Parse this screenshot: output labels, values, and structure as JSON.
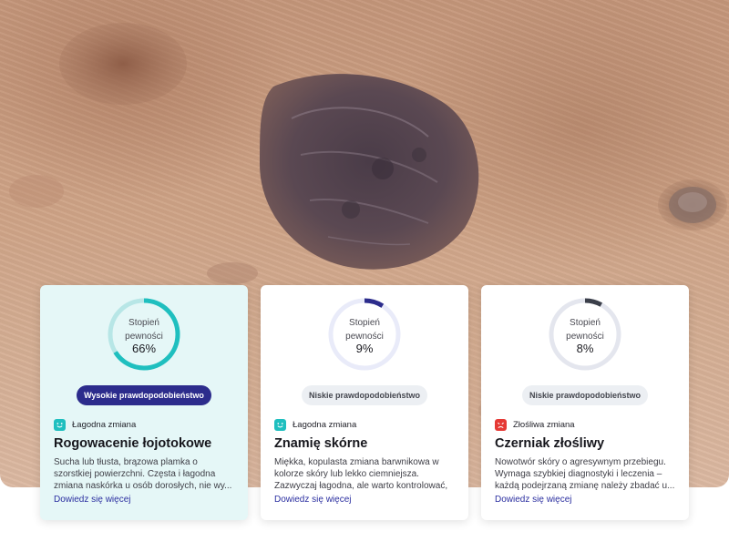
{
  "cards": [
    {
      "confidence_label_1": "Stopień",
      "confidence_label_2": "pewności",
      "confidence_value": "66%",
      "confidence_fraction": 0.66,
      "badge": "Wysokie prawdopodobieństwo",
      "type_label": "Łagodna zmiana",
      "type_icon": "happy-face-icon",
      "title": "Rogowacenie łojotokowe",
      "description": "Sucha lub tłusta, brązowa plamka o szorstkiej powierzchni. Częsta i łagodna zmiana naskórka u osób dorosłych, nie wy...",
      "link": "Dowiedz się więcej"
    },
    {
      "confidence_label_1": "Stopień",
      "confidence_label_2": "pewności",
      "confidence_value": "9%",
      "confidence_fraction": 0.09,
      "badge": "Niskie prawdopodobieństwo",
      "type_label": "Łagodna zmiana",
      "type_icon": "happy-face-icon",
      "title": "Znamię skórne",
      "description": "Miękka, kopulasta zmiana barwnikowa w kolorze skóry lub lekko ciemniejsza. Zazwyczaj łagodna, ale warto kontrolować, ...",
      "link": "Dowiedz się więcej"
    },
    {
      "confidence_label_1": "Stopień",
      "confidence_label_2": "pewności",
      "confidence_value": "8%",
      "confidence_fraction": 0.08,
      "badge": "Niskie prawdopodobieństwo",
      "type_label": "Złośliwa zmiana",
      "type_icon": "sad-face-icon",
      "title": "Czerniak złośliwy",
      "description": "Nowotwór skóry o agresywnym przebiegu. Wymaga szybkiej diagnostyki i leczenia – każdą podejrzaną zmianę należy zbadać u...",
      "link": "Dowiedz się więcej"
    }
  ],
  "colors": {
    "teal": "#1fbfbf",
    "navy": "#2c2c8c",
    "dark_gray": "#3b3f4a",
    "red": "#e53935",
    "link": "#2b2fa0"
  }
}
